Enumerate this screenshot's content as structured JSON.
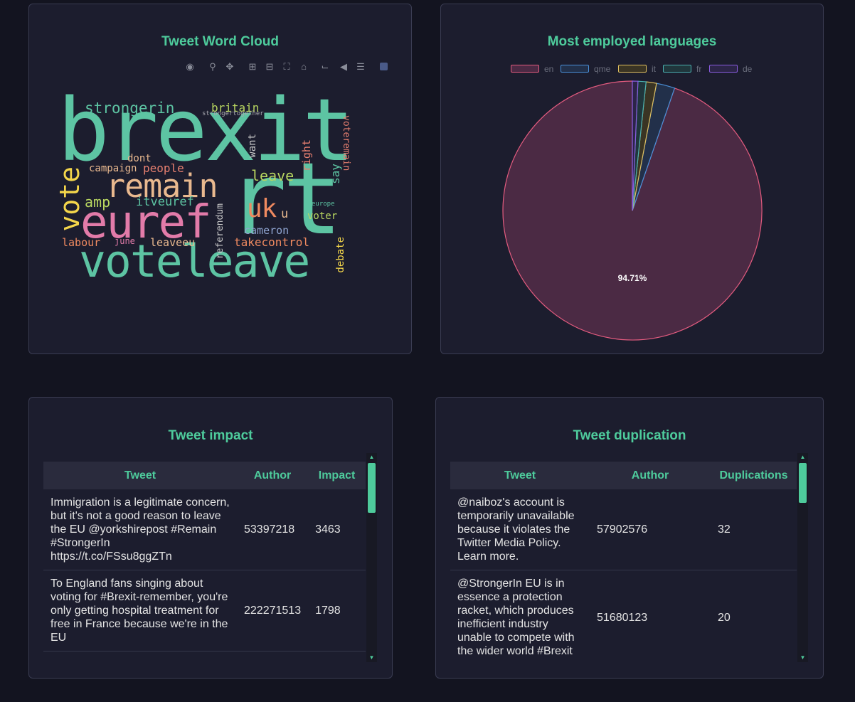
{
  "wordcloud": {
    "title": "Tweet Word Cloud",
    "toolbar_icons": [
      "camera-icon",
      "zoom-icon",
      "pan-icon",
      "zoom-in-icon",
      "zoom-out-icon",
      "autoscale-icon",
      "home-icon",
      "spike-lines-icon",
      "hover-closest-icon",
      "hover-compare-icon",
      "plotly-logo-icon"
    ],
    "words": [
      "brexit",
      "rt",
      "voteleave",
      "euref",
      "remain",
      "vote",
      "strongerin",
      "britain",
      "strongertogether",
      "want",
      "right",
      "voteremain",
      "dont",
      "campaign",
      "people",
      "leave",
      "say",
      "amp",
      "itveuref",
      "uk",
      "u",
      "europe",
      "voter",
      "referendum",
      "cameron",
      "labour",
      "june",
      "leaveeu",
      "takecontrol",
      "debate"
    ]
  },
  "languages": {
    "title": "Most employed languages",
    "legend": [
      "en",
      "qme",
      "it",
      "fr",
      "de"
    ],
    "pct_label": "94.71%"
  },
  "chart_data": {
    "type": "pie",
    "title": "Most employed languages",
    "labels": [
      "en",
      "qme",
      "it",
      "fr",
      "de"
    ],
    "values": [
      94.71,
      2.3,
      1.3,
      1.0,
      0.69
    ],
    "colors": [
      "#e35b7f",
      "#4a90d9",
      "#e0c060",
      "#4ab0b0",
      "#8a5ce0"
    ]
  },
  "impact": {
    "title": "Tweet impact",
    "headers": [
      "Tweet",
      "Author",
      "Impact"
    ],
    "rows": [
      {
        "tweet": "Immigration is a legitimate concern, but it's not a good reason to leave the EU @yorkshirepost #Remain #StrongerIn https://t.co/FSsu8ggZTn",
        "author": "53397218",
        "impact": "3463"
      },
      {
        "tweet": "To England fans singing about voting for #Brexit-remember, you're only getting hospital treatment for free in France because we're in the EU",
        "author": "222271513",
        "impact": "1798"
      }
    ]
  },
  "duplication": {
    "title": "Tweet duplication",
    "headers": [
      "Tweet",
      "Author",
      "Duplications"
    ],
    "rows": [
      {
        "tweet": "@naiboz's account is temporarily unavailable because it violates the Twitter Media Policy. Learn more.",
        "author": "57902576",
        "dups": "32"
      },
      {
        "tweet": "@StrongerIn EU is in essence a protection racket, which produces inefficient industry unable to compete with the wider world #Brexit",
        "author": "51680123",
        "dups": "20"
      }
    ]
  }
}
